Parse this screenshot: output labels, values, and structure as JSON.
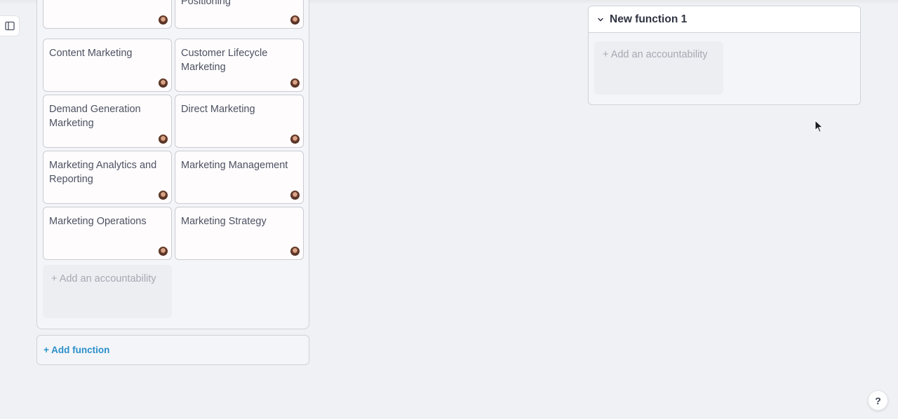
{
  "functions": {
    "marketing": {
      "cards": [
        {
          "label": ""
        },
        {
          "label": "Positioning"
        },
        {
          "label": "Content Marketing"
        },
        {
          "label": "Customer Lifecycle Marketing"
        },
        {
          "label": "Demand Generation Marketing"
        },
        {
          "label": "Direct Marketing"
        },
        {
          "label": "Marketing Analytics and Reporting"
        },
        {
          "label": "Marketing Management"
        },
        {
          "label": "Marketing Operations"
        },
        {
          "label": "Marketing Strategy"
        }
      ],
      "add_accountability_label": "+ Add an accountability"
    },
    "new_function": {
      "title": "New function 1",
      "add_accountability_label": "+ Add an accountability"
    }
  },
  "add_function_label": "+ Add function",
  "help_label": "?",
  "icons": {
    "sidebar_toggle": "sidebar-panel-icon",
    "collapse": "chevron-down-icon",
    "cursor": "mouse-pointer-icon",
    "avatar": "user-avatar"
  },
  "colors": {
    "accent_link": "#2a8fca",
    "background": "#f0f1f4",
    "card_border": "#c9ccd2"
  }
}
